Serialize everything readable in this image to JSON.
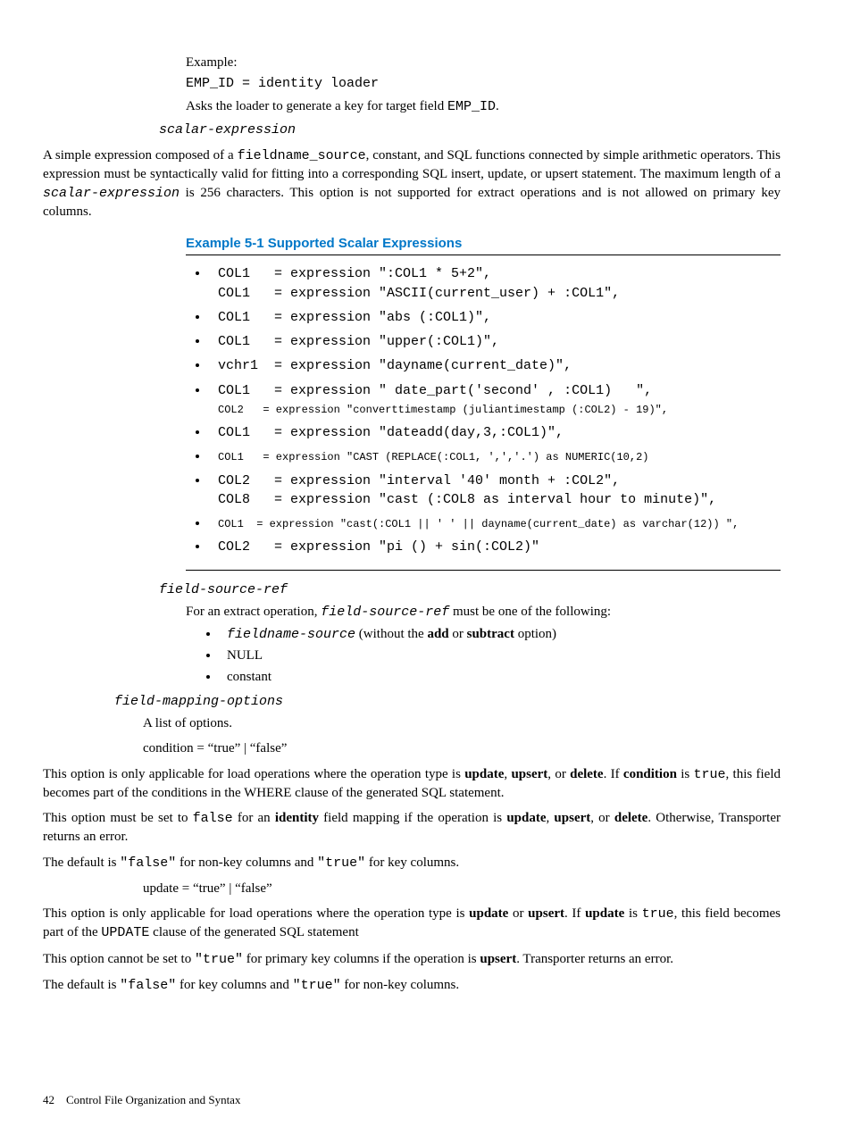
{
  "section1": {
    "exampleLabel": "Example:",
    "code": "EMP_ID = identity loader",
    "asks_pre": "Asks the loader to generate a key for target field ",
    "asks_code": "EMP_ID",
    "asks_post": "."
  },
  "scalar": {
    "heading": "scalar-expression",
    "p1_a": "A simple expression composed of a ",
    "p1_b": "fieldname_source",
    "p1_c": ", constant, and SQL functions connected by simple arithmetic operators. This expression must be syntactically valid for fitting into a corresponding SQL insert, update, or upsert statement. The maximum length of a ",
    "p1_d": "scalar-expression",
    "p1_e": " is 256 characters. This option is not supported for extract operations and is not allowed on primary key columns."
  },
  "example": {
    "title": "Example 5-1 Supported Scalar Expressions",
    "items": [
      "COL1   = expression \":COL1 * 5+2\",\nCOL1   = expression \"ASCII(current_user) + :COL1\",",
      "COL1   = expression \"abs (:COL1)\",",
      "COL1   = expression \"upper(:COL1)\",",
      "vchr1  = expression \"dayname(current_date)\",",
      "COL1   = expression \" date_part('second' , :COL1)   \",\nCOL2   = expression \"converttimestamp (juliantimestamp (:COL2) - 19)\",",
      "COL1   = expression \"dateadd(day,3,:COL1)\",",
      "COL1   = expression \"CAST (REPLACE(:COL1, ',','.') as NUMERIC(10,2)",
      "COL2   = expression \"interval '40' month + :COL2\",\nCOL8   = expression \"cast (:COL8 as interval hour to minute)\",",
      "COL1  = expression \"cast(:COL1 || ' ' || dayname(current_date) as varchar(12)) \",",
      "COL2   = expression \"pi () + sin(:COL2)\""
    ]
  },
  "fieldSourceRef": {
    "heading": "field-source-ref",
    "p1_a": "For an extract operation, ",
    "p1_b": "field-source-ref",
    "p1_c": " must be one of the following:",
    "bullets": {
      "b1_a": "fieldname-source",
      "b1_b": " (without the ",
      "b1_add": "add",
      "b1_or": " or ",
      "b1_sub": "subtract",
      "b1_c": " option)",
      "b2": "NULL",
      "b3": "constant"
    }
  },
  "mappingOptions": {
    "heading": "field-mapping-options",
    "listText": "A list of options.",
    "condition": {
      "line": "condition = “true” | “false”",
      "p1_a": "This option is only applicable for load operations where the operation type is ",
      "p1_update": "update",
      "p1_b": ", ",
      "p1_upsert": "upsert",
      "p1_c": ", or ",
      "p1_delete": "delete",
      "p1_d": ". If ",
      "p1_cond": "condition",
      "p1_e": " is ",
      "p1_true": "true",
      "p1_f": ", this field becomes part of the conditions in the WHERE clause of the generated SQL statement.",
      "p2_a": "This option must be set to ",
      "p2_false": "false",
      "p2_b": " for an ",
      "p2_identity": "identity",
      "p2_c": " field mapping if the operation is ",
      "p2_update": "update",
      "p2_d": ", ",
      "p2_upsert": "upsert",
      "p2_e": ", or ",
      "p2_delete": "delete",
      "p2_f": ". Otherwise, Transporter returns an error.",
      "p3_a": "The default is ",
      "p3_false": "\"false\"",
      "p3_b": " for non-key columns and ",
      "p3_true": "\"true\"",
      "p3_c": " for key columns."
    },
    "update": {
      "line": "update = “true” | “false”",
      "p1_a": "This option is only applicable for load operations where the operation type is ",
      "p1_update": "update",
      "p1_b": " or ",
      "p1_upsert": "upsert",
      "p1_c": ". If ",
      "p1_upd": "update",
      "p1_d": " is ",
      "p1_true": "true",
      "p1_e": ", this field becomes part of the ",
      "p1_clause": "UPDATE",
      "p1_f": " clause of the generated SQL statement",
      "p2_a": "This option cannot be set to ",
      "p2_true": "\"true\"",
      "p2_b": " for primary key columns if the operation is ",
      "p2_upsert": "upsert",
      "p2_c": ". Transporter returns an error.",
      "p3_a": "The default is ",
      "p3_false": "\"false\"",
      "p3_b": " for key columns and ",
      "p3_true": "\"true\"",
      "p3_c": " for non-key columns."
    }
  },
  "footer": {
    "page": "42",
    "title": "Control File Organization and Syntax"
  }
}
